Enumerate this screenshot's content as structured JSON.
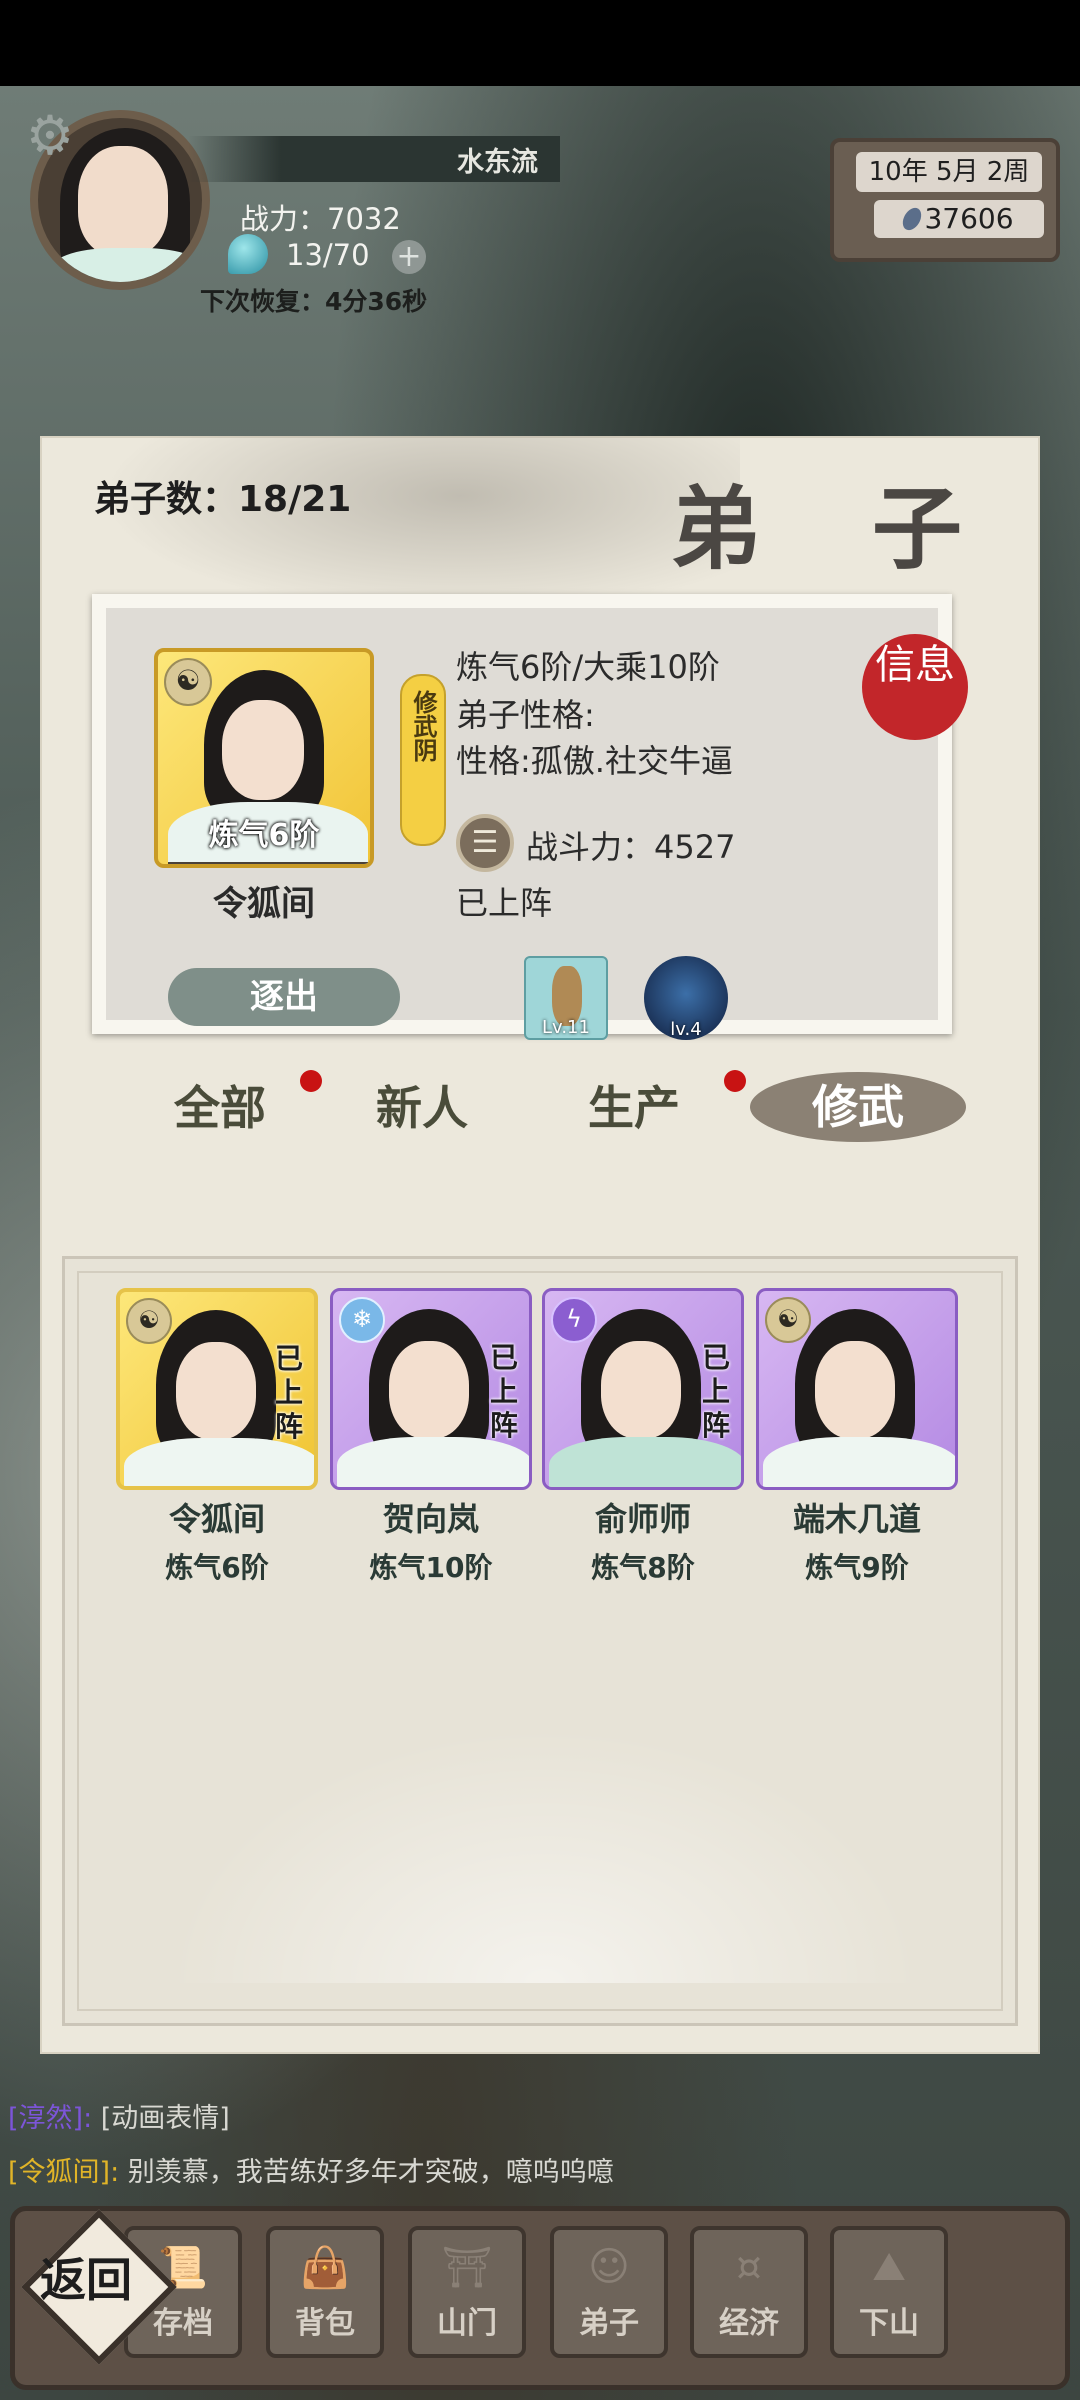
{
  "hud": {
    "player_name": "水东流",
    "power": "战力：7032",
    "stamina": "13/70",
    "plus": "+",
    "recover": "下次恢复：4分36秒",
    "date": "10年  5月  2周",
    "currency": "37606",
    "gear": "⚙"
  },
  "panel": {
    "count": "弟子数：18/21",
    "title": "弟 子"
  },
  "selected": {
    "realm": "炼气6阶",
    "name": "令狐间",
    "tag": "修武阴",
    "stage": "炼气6阶/大乘10阶",
    "personality_label": "弟子性格:",
    "personality": "性格:孤傲.社交牛逼",
    "combat": "战斗力：4527",
    "status": "已上阵",
    "seal": "信息",
    "expel": "逐出",
    "items": [
      {
        "level": "Lv.11"
      },
      {
        "level": "lv.4"
      }
    ]
  },
  "tabs": [
    "全部",
    "新人",
    "生产",
    "修武"
  ],
  "roster": [
    {
      "name": "令狐间",
      "level": "炼气6阶",
      "status": "已上阵"
    },
    {
      "name": "贺向岚",
      "level": "炼气10阶",
      "status": "已上阵"
    },
    {
      "name": "俞师师",
      "level": "炼气8阶",
      "status": "已上阵"
    },
    {
      "name": "端木几道",
      "level": "炼气9阶",
      "status": ""
    }
  ],
  "chat": [
    {
      "who": "[令狐间]:",
      "msg": "别羡慕，我苦练好多年才突破，噫呜呜噫"
    },
    {
      "who": "[淳然]:",
      "msg": "[动画表情]"
    }
  ],
  "nav": [
    "存档",
    "背包",
    "山门",
    "弟子",
    "经济",
    "下山"
  ],
  "back": "返回",
  "colors": {
    "accent_red": "#c81313",
    "gold": "#f1c436",
    "purple": "#b48ae3"
  }
}
